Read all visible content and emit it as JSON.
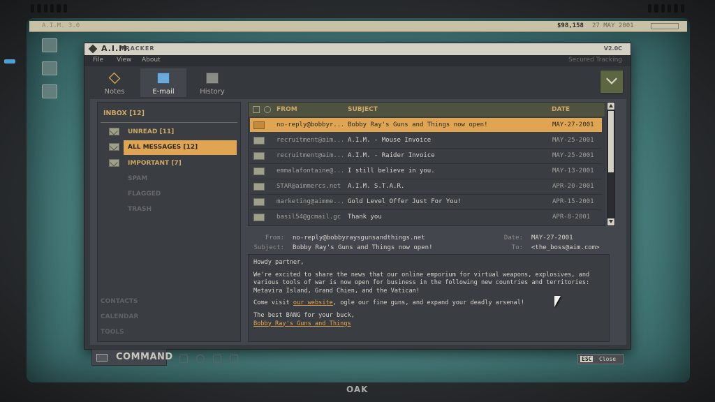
{
  "os": {
    "name": "A.I.M. 3.0",
    "money": "$98,158",
    "date": "27 MAY 2001"
  },
  "window": {
    "title": "A.I.M.",
    "subtitle": "TRACKER",
    "version": "V2.0C"
  },
  "menu": {
    "items": [
      "File",
      "View",
      "About"
    ],
    "secured": "Secured Tracking"
  },
  "tabs": [
    {
      "label": "Notes",
      "icon": "notes-alert-icon"
    },
    {
      "label": "E-mail",
      "icon": "envelope-alert-icon",
      "active": true
    },
    {
      "label": "History",
      "icon": "folder-icon"
    }
  ],
  "sidebar": {
    "inbox": "INBOX [12]",
    "folders": [
      {
        "label": "UNREAD [11]"
      },
      {
        "label": "ALL MESSAGES [12]",
        "selected": true
      },
      {
        "label": "IMPORTANT [7]"
      },
      {
        "label": "SPAM"
      },
      {
        "label": "FLAGGED"
      },
      {
        "label": "TRASH"
      }
    ],
    "bottom": [
      "CONTACTS",
      "CALENDAR",
      "TOOLS"
    ]
  },
  "list": {
    "headers": {
      "from": "FROM",
      "subject": "SUBJECT",
      "date": "DATE"
    },
    "rows": [
      {
        "from": "no-reply@bobbyr...",
        "subject": "Bobby Ray's Guns and Things now open!",
        "date": "MAY-27-2001"
      },
      {
        "from": "recruitment@aim...",
        "subject": "A.I.M. - Mouse Invoice",
        "date": "MAY-25-2001"
      },
      {
        "from": "recruitment@aim...",
        "subject": "A.I.M. - Raider Invoice",
        "date": "MAY-25-2001"
      },
      {
        "from": "emmalafontaine@...",
        "subject": "I still believe in you.",
        "date": "MAY-13-2001"
      },
      {
        "from": "STAR@aimmercs.net",
        "subject": "A.I.M. S.T.A.R.",
        "date": "APR-20-2001"
      },
      {
        "from": "marketing@aimme...",
        "subject": "Gold Level Offer Just For You!",
        "date": "APR-15-2001"
      },
      {
        "from": "basil54@gcmail.gc",
        "subject": "Thank you",
        "date": "APR-8-2001"
      }
    ]
  },
  "message": {
    "from_label": "From:",
    "from": "no-reply@bobbyraysgunsandthings.net",
    "subject_label": "Subject:",
    "subject": "Bobby Ray's Guns and Things now open!",
    "date_label": "Date:",
    "date": "MAY-27-2001",
    "to_label": "To:",
    "to": "<the_boss@aim.com>",
    "greeting": "Howdy partner,",
    "para1": "We're excited to share the news that our online emporium for virtual weapons, explosives, and various tools of war is now open for business in the following new countries and territories: Metavira Island, Grand Chien, and the Vatican!",
    "visit_pre": "Come visit ",
    "visit_link": "our website",
    "visit_post": ", ogle our fine guns, and expand your deadly arsenal!",
    "sign1": "The best BANG for your buck,",
    "sign2": "Bobby Ray's Guns and Things"
  },
  "bottombar": {
    "command": "COMMAND",
    "esc": "ESC",
    "close": "Close"
  },
  "monitor": {
    "brand": "OAK"
  },
  "colors": {
    "accent": "#e0a552",
    "screen": "#5c9896"
  }
}
